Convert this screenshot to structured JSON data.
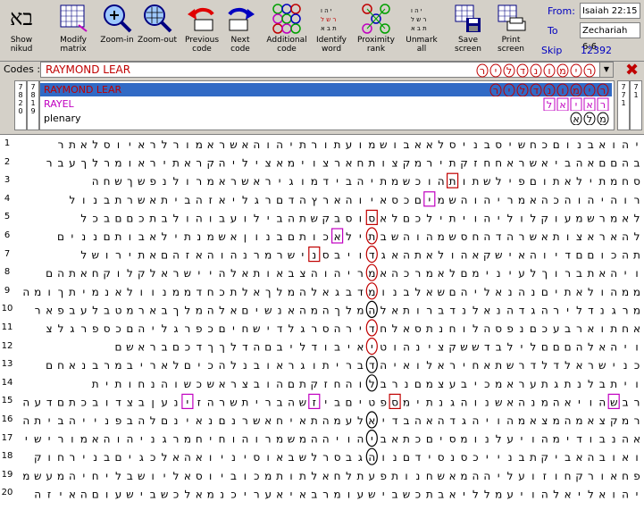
{
  "toolbar": {
    "logo_text": "בא",
    "buttons": [
      {
        "id": "show-nikud",
        "label": "Show\nnikud"
      },
      {
        "id": "modify-matrix",
        "label": "Modify\nmatrix"
      },
      {
        "id": "zoom-in",
        "label": "Zoom-in"
      },
      {
        "id": "zoom-out",
        "label": "Zoom-out"
      },
      {
        "id": "previous-code",
        "label": "Previous\ncode"
      },
      {
        "id": "next-code",
        "label": "Next\ncode"
      },
      {
        "id": "additional-code",
        "label": "Additional\ncode"
      },
      {
        "id": "identify-word",
        "label": "Identify\nword"
      },
      {
        "id": "proximity-rank",
        "label": "Proximity\nrank"
      },
      {
        "id": "unmark-all",
        "label": "Unmark\nall"
      },
      {
        "id": "save-screen",
        "label": "Save\nscreen"
      },
      {
        "id": "print-screen",
        "label": "Print\nscreen"
      }
    ],
    "from_label": "From:",
    "from_value": "Isaiah 22:15",
    "to_label": "To",
    "to_value": "Zechariah 6:6",
    "skip_label": "Skip",
    "skip_value": "12392"
  },
  "codes": {
    "label": "Codes :",
    "value": "RAYMOND LEAR",
    "hebrew": "רימונדליר"
  },
  "code_list": {
    "left_numbers": [
      "7",
      "8",
      "2",
      "0"
    ],
    "left_numbers2": [
      "7",
      "8",
      "1",
      "9"
    ],
    "right_numbers": [
      "7",
      "7",
      "1"
    ],
    "right_numbers2": [
      "7",
      "1"
    ],
    "items": [
      {
        "text": "RAYMOND LEAR",
        "color": "#c00000",
        "hebrew": "רימונדליר",
        "selected": true
      },
      {
        "text": "RAYEL",
        "color": "#c000c0",
        "hebrew": "ראיאל",
        "selected": false
      },
      {
        "text": "plenary",
        "color": "#000000",
        "hebrew": "מלא",
        "selected": false
      }
    ]
  },
  "grid": {
    "row_numbers": [
      "1",
      "2",
      "3",
      "4",
      "5",
      "6",
      "7",
      "8",
      "9",
      "10",
      "11",
      "12",
      "13",
      "14",
      "15",
      "16",
      "17",
      "18",
      "19",
      "20"
    ],
    "rows": [
      "יהואבנוםכחשיסבניסלאאבושמועתורתיהוהאשראמורלראיוסלאתר",
      "בהםםאהביאשראחחזקתירמקצותחארצוימאציליהקראתיראומרלךעבר",
      "סחמתילאתוםפילשתותהוכשמתיהבידמוגיראשראמרולנפשךשחה",
      "רוהיהוהכהאמריהוהשמיםכסאיוהארץהדםרגליאזהביתאשרתבנול",
      "לאמרשמעוקלוליהויתילכםלאסוסבקשתהבילועבוהולבתכםםבכל",
      "להאראצותאשרהדהחסשמהוהשבתילאכותםבנוןאשמנתילאבותםננים",
      "תהכוםםדיוהאישקאהולאתהאגדויבסנישרמרנהוהאזהםאתירושל",
      "ויהאתברוךלעינימםלאמרכהאמריהוהצבאותאלהיישראלקלוקחאתהם",
      "ממהולאתיםנהנאליהםשאלבנומדבגאלהמלךאלתכחדממנוולאנמיתךומה",
      "מרגנדלירהגדהנאלנדברותאלהמלךהמהאנשיםאלהמלךבארמטבלעבפאר",
      "אחתוארבעכםנפסהלוחנתסאלחדירהסרגלדישחיםכפרגליהםכספרגלצ",
      "ויהאלהםםםלילבדששקצינהוטיאיבודליבםהדלךךדכםבראשם",
      "כנישראלדלדרשתאחיראלואיהדבריתוגראובנלהכיםלאריבמרבנאחם",
      "ויתבלנתגתעראמכיבעצמםנרבלוהחזקתםהובצראשכשוהנחותית",
      "רבשהויאהמנהאשנוהגנתימספטיםביזשהבריתשרהזינעןבצדובכתםדעה",
      "רמקצאמהמצאמהויהגדהאהבדיאלעמהתאיחאשרנםנאינםלהבפנייהביתה",
      "אהנבודימהויעלנומסיםכתאביהויההמשמרוהוחיחמרגניהוהאמורישיבהש",
      "ואובהאביקתבנייכסנסידםנוהגבסרלשבאוסיניואהאלכגיםבנירחוק",
      "פחאורקחוזועליההמאשחנותפעתלחאלתותמכוביוסאליושבליחיהמעשמ",
      "יהואליאלהויעמלליאבתכשבישעומרבאיאעריכנמאלכשבישעוםהאיזה"
    ],
    "marks": [
      {
        "row": 3,
        "col": 16,
        "type": "box",
        "color": "#c00000"
      },
      {
        "row": 4,
        "col": 18,
        "type": "box",
        "color": "#c000c0"
      },
      {
        "row": 5,
        "col": 23,
        "type": "box",
        "color": "#c00000"
      },
      {
        "row": 6,
        "col": 23,
        "type": "oval",
        "color": "#c00000"
      },
      {
        "row": 6,
        "col": 26,
        "type": "box",
        "color": "#c000c0"
      },
      {
        "row": 7,
        "col": 23,
        "type": "oval",
        "color": "#c00000"
      },
      {
        "row": 7,
        "col": 28,
        "type": "box",
        "color": "#c00000"
      },
      {
        "row": 8,
        "col": 23,
        "type": "oval",
        "color": "#c00000"
      },
      {
        "row": 9,
        "col": 23,
        "type": "oval",
        "color": "#c00000"
      },
      {
        "row": 10,
        "col": 23,
        "type": "oval",
        "color": "#000000"
      },
      {
        "row": 11,
        "col": 23,
        "type": "oval",
        "color": "#c00000"
      },
      {
        "row": 12,
        "col": 23,
        "type": "oval",
        "color": "#c00000"
      },
      {
        "row": 13,
        "col": 23,
        "type": "oval",
        "color": "#000000"
      },
      {
        "row": 14,
        "col": 23,
        "type": "oval",
        "color": "#000000"
      },
      {
        "row": 15,
        "col": 2,
        "type": "box",
        "color": "#c000c0"
      },
      {
        "row": 15,
        "col": 21,
        "type": "box",
        "color": "#c00000"
      },
      {
        "row": 15,
        "col": 28,
        "type": "box",
        "color": "#c000c0"
      },
      {
        "row": 15,
        "col": 39,
        "type": "box",
        "color": "#c000c0"
      },
      {
        "row": 16,
        "col": 23,
        "type": "oval",
        "color": "#000000"
      },
      {
        "row": 17,
        "col": 23,
        "type": "oval",
        "color": "#000000"
      },
      {
        "row": 18,
        "col": 23,
        "type": "oval",
        "color": "#000000"
      }
    ]
  }
}
